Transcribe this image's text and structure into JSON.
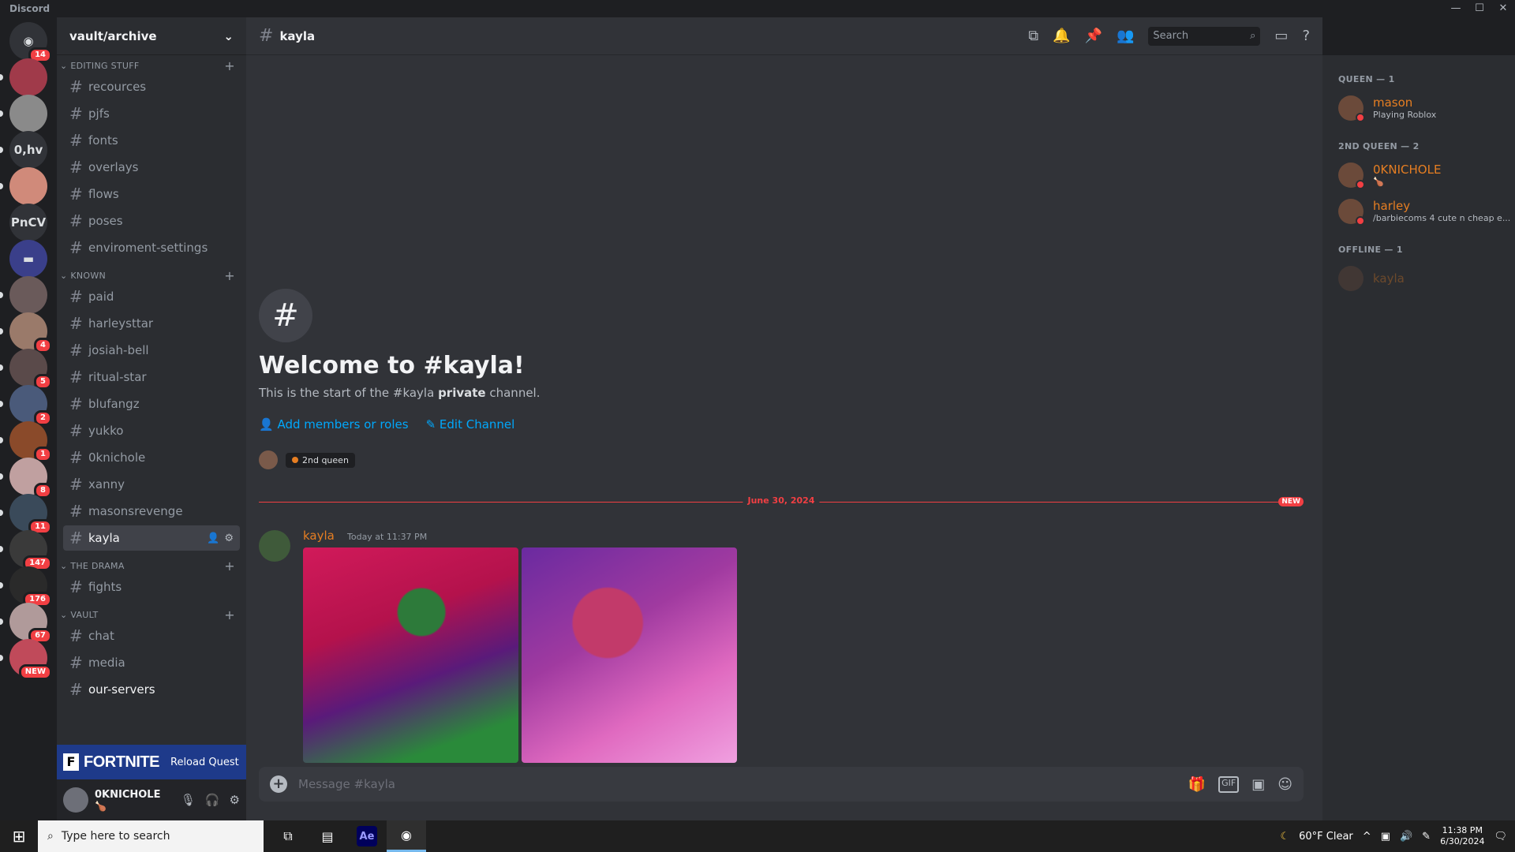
{
  "window": {
    "app_name": "Discord",
    "controls": [
      "—",
      "☐",
      "✕"
    ]
  },
  "servers": [
    {
      "label": "",
      "badge": "14",
      "icon": "discord-logo-icon",
      "color": "#313338"
    },
    {
      "label": "",
      "badge": "",
      "color": "#a03a4a"
    },
    {
      "label": "",
      "badge": "",
      "color": "#8a8a8a"
    },
    {
      "label": "0,hv",
      "badge": "",
      "color": "#313338"
    },
    {
      "label": "",
      "badge": "",
      "color": "#d08a7a"
    },
    {
      "label": "PnCV",
      "badge": "",
      "color": "#313338"
    },
    {
      "label": "",
      "badge": "",
      "icon": "folder-icon",
      "color": "#3a3f8a"
    },
    {
      "label": "",
      "badge": "",
      "color": "#6a5a5a"
    },
    {
      "label": "",
      "badge": "4",
      "color": "#9a7a6a"
    },
    {
      "label": "",
      "badge": "5",
      "color": "#5a4a4a"
    },
    {
      "label": "",
      "badge": "2",
      "color": "#4a5a7a"
    },
    {
      "label": "",
      "badge": "1",
      "color": "#8a4a2a"
    },
    {
      "label": "",
      "badge": "8",
      "color": "#c0a0a0"
    },
    {
      "label": "",
      "badge": "11",
      "color": "#3a4a5a"
    },
    {
      "label": "",
      "badge": "147",
      "color": "#3a3a3a"
    },
    {
      "label": "",
      "badge": "176",
      "color": "#2a2a2a"
    },
    {
      "label": "",
      "badge": "67",
      "color": "#b09a9a"
    },
    {
      "label": "",
      "badge": "NEW",
      "color": "#c04a5a"
    }
  ],
  "guild": {
    "name": "vault/archive",
    "chevron": "⌄"
  },
  "categories": [
    {
      "name": "EDITING STUFF",
      "channels": [
        "recources",
        "pjfs",
        "fonts",
        "overlays",
        "flows",
        "poses",
        "enviroment-settings"
      ]
    },
    {
      "name": "KNOWN",
      "channels": [
        "paid",
        "harleysttar",
        "josiah-bell",
        "ritual-star",
        "blufangz",
        "yukko",
        "0knichole",
        "xanny",
        "masonsrevenge",
        "kayla"
      ]
    },
    {
      "name": "THE DRAMA",
      "channels": [
        "fights"
      ]
    },
    {
      "name": "VAULT",
      "channels": [
        "chat",
        "media",
        "our-servers"
      ]
    }
  ],
  "quest": {
    "f": "F",
    "brand": "FORTNITE",
    "label": "Reload Quest"
  },
  "user": {
    "name": "0KNICHOLE",
    "status": "🍗"
  },
  "topbar": {
    "channel": "kayla",
    "search_placeholder": "Search"
  },
  "welcome": {
    "title": "Welcome to #kayla!",
    "desc_pre": "This is the start of the #kayla ",
    "desc_bold": "private",
    "desc_post": " channel.",
    "add_members": "Add members or roles",
    "edit_channel": "Edit Channel",
    "role": "2nd queen"
  },
  "divider": {
    "date": "June 30, 2024",
    "new": "NEW"
  },
  "message": {
    "author": "kayla",
    "time": "Today at 11:37 PM"
  },
  "composer": {
    "placeholder": "Message #kayla",
    "gif": "GIF"
  },
  "members": [
    {
      "group": "QUEEN — 1",
      "people": [
        {
          "name": "mason",
          "sub": "Playing Roblox"
        }
      ]
    },
    {
      "group": "2ND QUEEN — 2",
      "people": [
        {
          "name": "0KNICHOLE",
          "sub": "🍗"
        },
        {
          "name": "harley",
          "sub": "/barbiecoms 4 cute n cheap e..."
        }
      ]
    },
    {
      "group": "OFFLINE — 1",
      "people": [
        {
          "name": "kayla",
          "sub": ""
        }
      ]
    }
  ],
  "taskbar": {
    "search": "Type here to search",
    "weather": "60°F  Clear",
    "time": "11:38 PM",
    "date": "6/30/2024",
    "ae": "Ae"
  }
}
